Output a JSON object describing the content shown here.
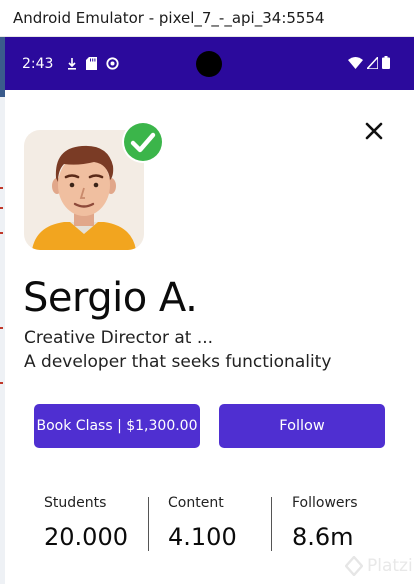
{
  "window": {
    "title": "Android Emulator - pixel_7_-_api_34:5554"
  },
  "status_bar": {
    "time": "2:43",
    "left_icons": [
      "download-icon",
      "sd-card-icon",
      "sync-icon"
    ],
    "right_icons": [
      "wifi-icon",
      "signal-icon",
      "battery-icon"
    ],
    "color": "#2b0a9c"
  },
  "profile": {
    "name": "Sergio A.",
    "role": "Creative Director at ...",
    "bio": "A developer that seeks functionality",
    "verified": true
  },
  "actions": {
    "book_label": "Book Class | $1,300.00",
    "follow_label": "Follow",
    "accent": "#4f2fd1"
  },
  "stats": [
    {
      "label": "Students",
      "value": "20.000"
    },
    {
      "label": "Content",
      "value": "4.100"
    },
    {
      "label": "Followers",
      "value": "8.6m"
    }
  ],
  "watermark": {
    "text": "Platzi"
  },
  "colors": {
    "verified_green": "#3bb54a"
  }
}
